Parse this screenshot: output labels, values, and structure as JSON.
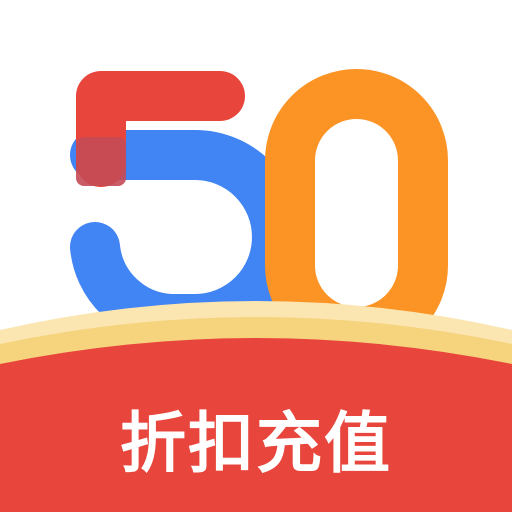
{
  "logo": {
    "digit_five": "5",
    "digit_zero": "0",
    "banner_label": "折扣充值"
  },
  "colors": {
    "background": "#ffffff",
    "five_top_red": "#e8453c",
    "five_bottom_blue": "#4184f3",
    "zero_orange": "#fb9325",
    "overlap": "#c44a55",
    "banner_red": "#e8453c",
    "banner_gold": "#f6d37d",
    "banner_cream": "#fbe6b2",
    "banner_text": "#ffffff"
  },
  "icons": {
    "logo": "50-discount-recharge-logo"
  }
}
